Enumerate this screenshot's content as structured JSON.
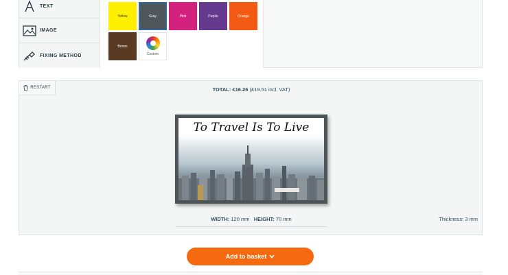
{
  "side_nav": {
    "items": [
      {
        "label": "TEXT",
        "icon": "text-icon"
      },
      {
        "label": "IMAGE",
        "icon": "image-icon"
      },
      {
        "label": "FIXING METHOD",
        "icon": "screw-icon"
      }
    ]
  },
  "swatches": [
    {
      "label": "Yellow",
      "color": "#ffef00"
    },
    {
      "label": "Gray",
      "color": "#50575b",
      "selected": true
    },
    {
      "label": "Pink",
      "color": "#d3217e"
    },
    {
      "label": "Purple",
      "color": "#65398e"
    },
    {
      "label": "Orange",
      "color": "#f35a14"
    },
    {
      "label": "Brown",
      "color": "#5a3a22"
    },
    {
      "label": "Custom",
      "icon": "color-wheel-icon"
    }
  ],
  "preview": {
    "restart_label": "RESTART",
    "total_label": "TOTAL: £16.26",
    "total_vat": "(£19.51 incl. VAT)",
    "sign_text": "To Travel Is To Live",
    "width_label": "WIDTH:",
    "width_value": "120 mm",
    "height_label": "HEIGHT:",
    "height_value": "70 mm",
    "thickness": "Thickness: 3 mm"
  },
  "actions": {
    "add_to_basket": "Add to basket"
  },
  "colors": {
    "accent": "#f56a10",
    "frame": "#4e5558"
  }
}
